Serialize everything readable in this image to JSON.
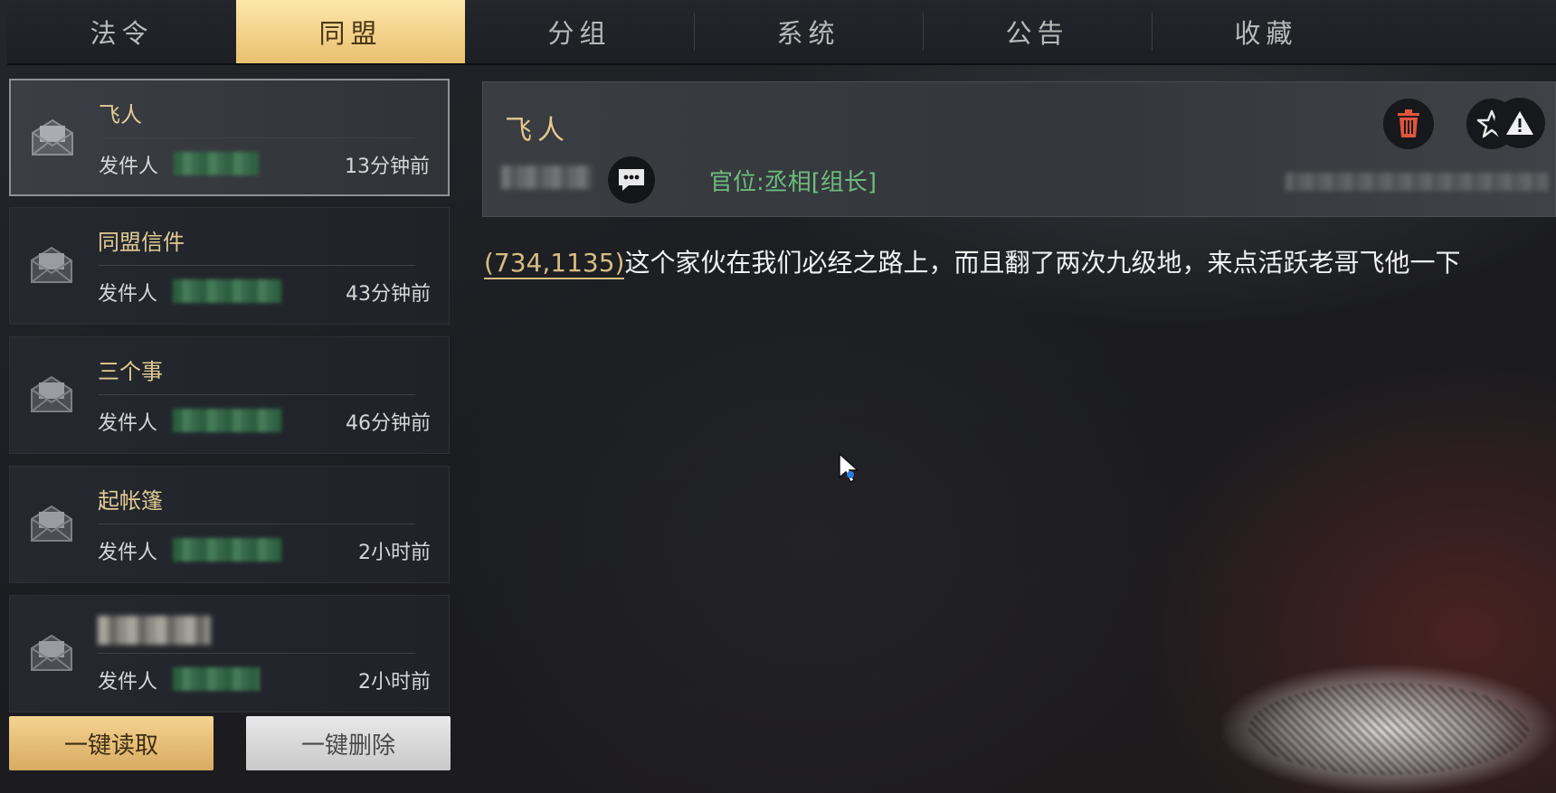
{
  "tabs": [
    {
      "label": "法令",
      "active": false
    },
    {
      "label": "同盟",
      "active": true
    },
    {
      "label": "分组",
      "active": false
    },
    {
      "label": "系统",
      "active": false
    },
    {
      "label": "公告",
      "active": false
    },
    {
      "label": "收藏",
      "active": false
    }
  ],
  "mails": [
    {
      "title": "飞人",
      "sender_label": "发件人",
      "time": "13分钟前",
      "selected": true
    },
    {
      "title": "同盟信件",
      "sender_label": "发件人",
      "time": "43分钟前",
      "selected": false
    },
    {
      "title": "三个事",
      "sender_label": "发件人",
      "time": "46分钟前",
      "selected": false
    },
    {
      "title": "起帐篷",
      "sender_label": "发件人",
      "time": "2小时前",
      "selected": false
    },
    {
      "title": "",
      "sender_label": "发件人",
      "time": "2小时前",
      "selected": false
    }
  ],
  "buttons": {
    "read_all": "一键读取",
    "delete_all": "一键删除"
  },
  "detail": {
    "title": "飞人",
    "rank": "官位:丞相[组长]",
    "coordinates": "(734,1135)",
    "message": "这个家伙在我们必经之路上，而且翻了两次九级地，来点活跃老哥飞他一下"
  },
  "colors": {
    "active_tab": "#f6d48a",
    "accent_gold": "#e2cb94",
    "rank_green": "#6dbb7e",
    "trash_red": "#e0553f"
  }
}
